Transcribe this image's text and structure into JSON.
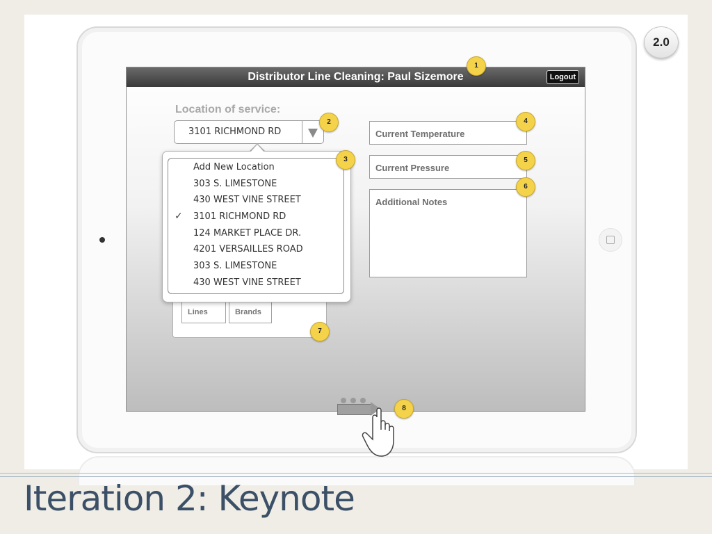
{
  "app": {
    "title": "Distributor Line Cleaning: Paul Sizemore",
    "logout_label": "Logout"
  },
  "location": {
    "label": "Location of service:",
    "selected": "3101 RICHMOND RD",
    "options": [
      {
        "label": "Add New Location",
        "checked": false
      },
      {
        "label": "303 S. LIMESTONE",
        "checked": false
      },
      {
        "label": "430 WEST VINE STREET",
        "checked": false
      },
      {
        "label": "3101 RICHMOND RD",
        "checked": true
      },
      {
        "label": "124 MARKET PLACE DR.",
        "checked": false
      },
      {
        "label": "4201 VERSAILLES ROAD",
        "checked": false
      },
      {
        "label": "303 S. LIMESTONE",
        "checked": false
      },
      {
        "label": "430 WEST VINE STREET",
        "checked": false
      }
    ],
    "check_glyph": "✓"
  },
  "tabs": {
    "lines": "Lines",
    "brands": "Brands"
  },
  "fields": {
    "temperature_placeholder": "Current Temperature",
    "pressure_placeholder": "Current Pressure",
    "notes_placeholder": "Additional Notes"
  },
  "badges": [
    "1",
    "2",
    "3",
    "4",
    "5",
    "6",
    "7",
    "8"
  ],
  "slide": {
    "version": "2.0",
    "title": "Iteration 2: Keynote"
  },
  "colors": {
    "badge": "#f4d34a",
    "titlebar": "#4a4a4a",
    "slide_title": "#3b4f66"
  },
  "icons": {
    "dropdown": "triangle-down-icon",
    "checkmark": "checkmark-icon",
    "swipe_arrow": "arrow-right-icon",
    "hand": "hand-pointer-icon"
  }
}
